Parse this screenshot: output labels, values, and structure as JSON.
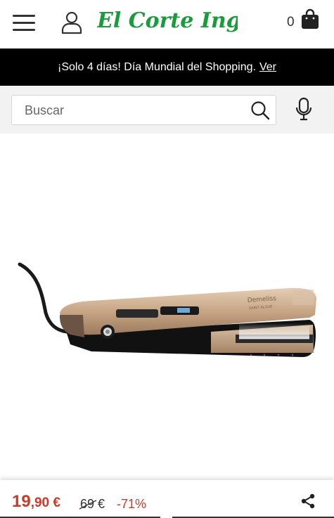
{
  "header": {
    "brand": "El Corte Inglés",
    "cart_count": "0"
  },
  "promo": {
    "text": "¡Solo 4 días! Día Mundial del Shopping.",
    "link": "Ver"
  },
  "search": {
    "placeholder": "Buscar"
  },
  "product": {
    "brand_text": "Demeliss",
    "model_text": "SAINT ALGUE"
  },
  "price": {
    "main": "19",
    "cents": ",90 €",
    "old_value": "69",
    "old_currency": "€",
    "discount": "-71%"
  },
  "colors": {
    "brand_green": "#1a9b3c",
    "price_red": "#c83a2a",
    "promo_bg": "#000000"
  },
  "icons": [
    "hamburger-menu-icon",
    "user-icon",
    "shopping-bag-icon",
    "search-icon",
    "microphone-icon",
    "share-icon"
  ]
}
